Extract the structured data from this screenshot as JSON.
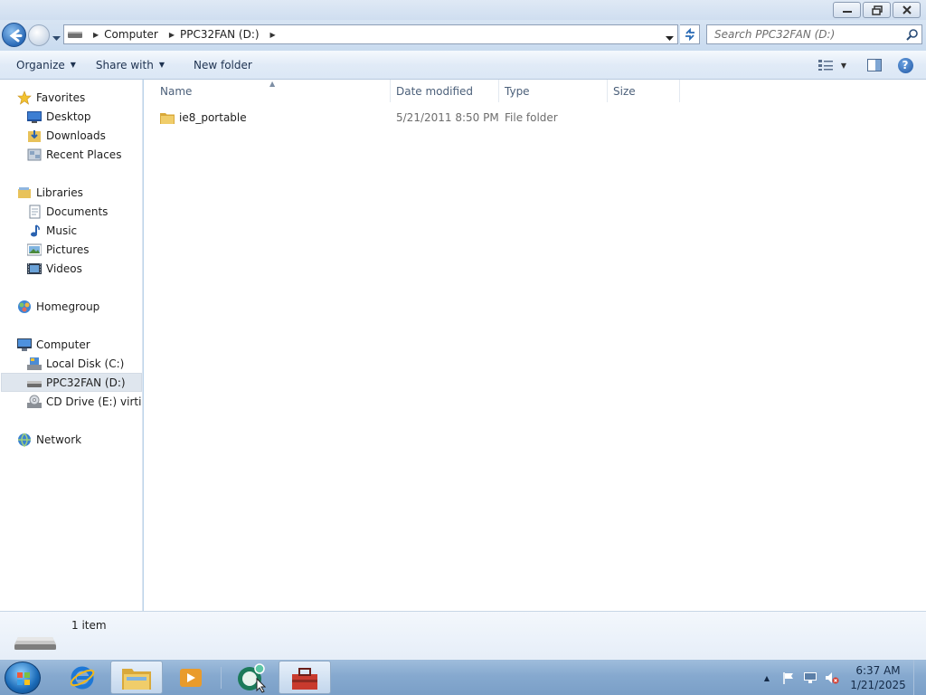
{
  "window": {
    "caption_buttons": [
      "minimize",
      "restore",
      "close"
    ]
  },
  "address": {
    "crumbs": [
      "Computer",
      "PPC32FAN (D:)"
    ],
    "search_placeholder": "Search PPC32FAN (D:)"
  },
  "toolbar": {
    "organize": "Organize",
    "share_with": "Share with",
    "new_folder": "New folder"
  },
  "nav": {
    "favorites": "Favorites",
    "desktop": "Desktop",
    "downloads": "Downloads",
    "recent_places": "Recent Places",
    "libraries": "Libraries",
    "documents": "Documents",
    "music": "Music",
    "pictures": "Pictures",
    "videos": "Videos",
    "homegroup": "Homegroup",
    "computer": "Computer",
    "local_disk": "Local Disk (C:)",
    "ppc32fan": "PPC32FAN (D:)",
    "cd_drive": "CD Drive (E:) virtio-v",
    "network": "Network"
  },
  "columns": {
    "name": "Name",
    "date_modified": "Date modified",
    "type": "Type",
    "size": "Size"
  },
  "files": [
    {
      "name": "ie8_portable",
      "date_modified": "5/21/2011 8:50 PM",
      "type": "File folder",
      "size": ""
    }
  ],
  "details": {
    "item_count": "1 item"
  },
  "taskbar": {
    "clock_time": "6:37 AM",
    "clock_date": "1/21/2025"
  },
  "colors": {
    "accent": "#2b6bb8",
    "folder": "#e8c25a"
  }
}
